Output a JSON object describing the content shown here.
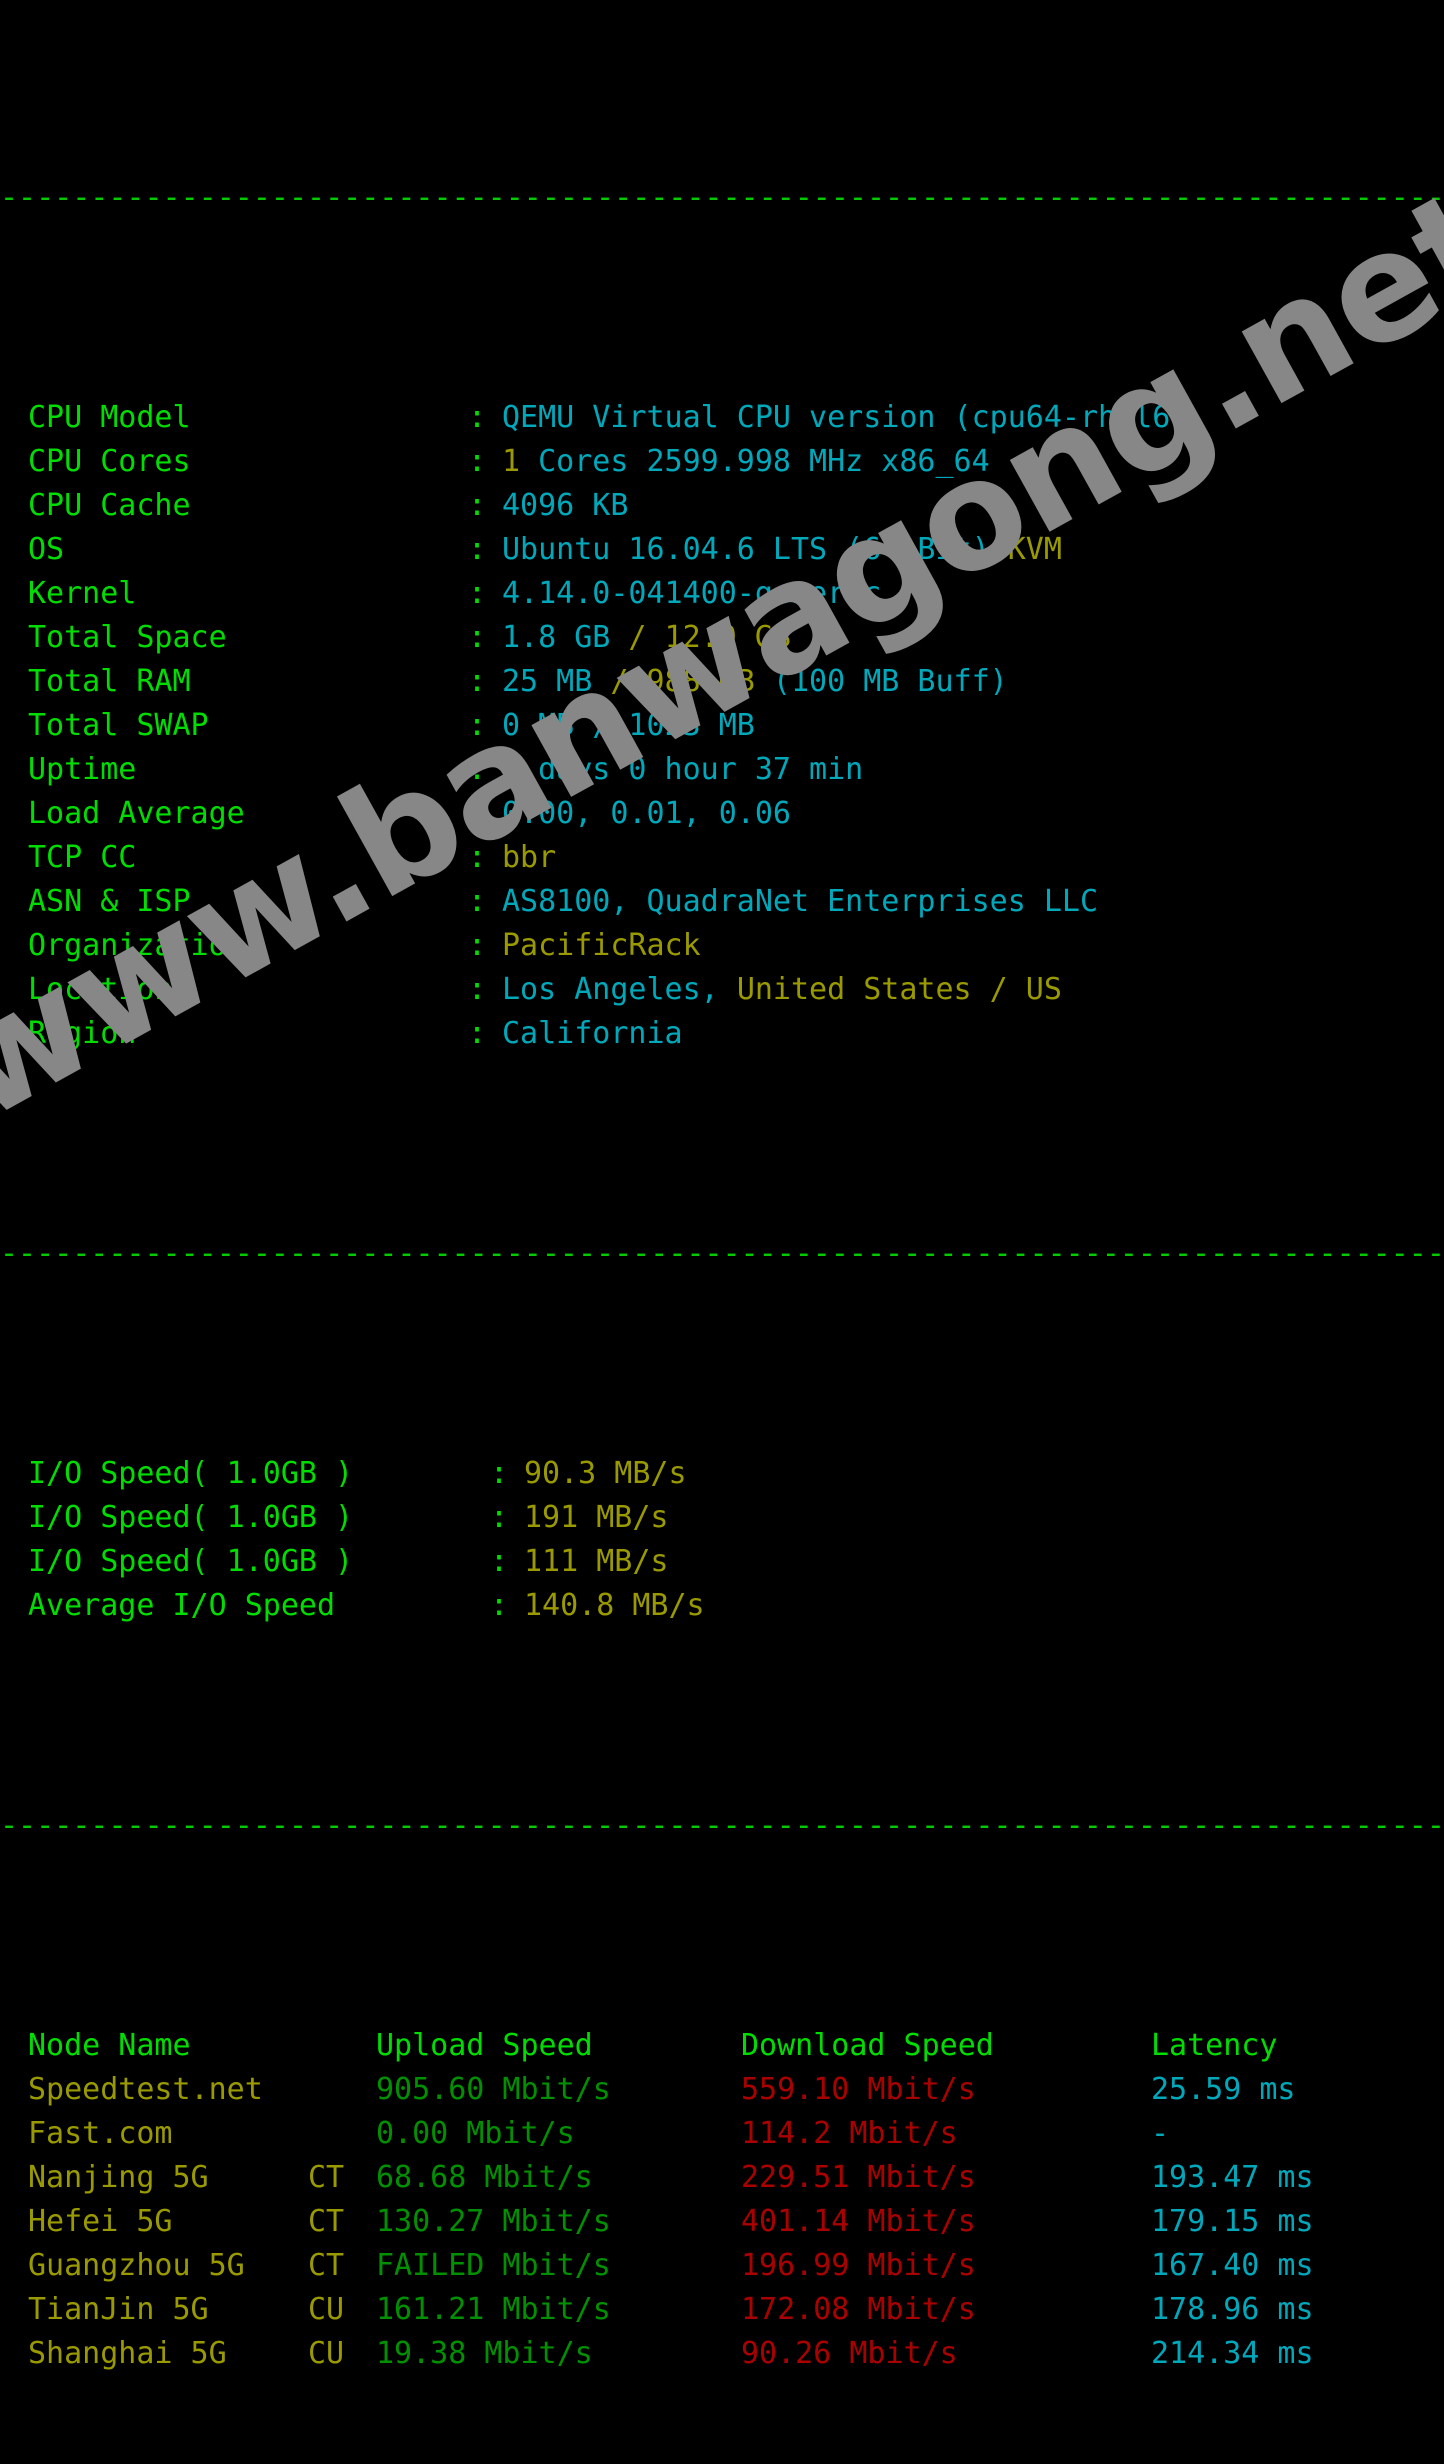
{
  "terminal": {
    "separator_char": "-",
    "colon": ":"
  },
  "watermark": {
    "text": "www.banwagong.net",
    "color": "#878787"
  },
  "colors": {
    "label_green": "#00dd00",
    "value_cyan": "#00a8bb",
    "value_yellow": "#9a9a00",
    "download_red": "#aa0000",
    "upload_green": "#009000",
    "separator_green": "#00cc00",
    "background": "#000000"
  },
  "system_info": [
    {
      "label": "CPU Model",
      "value": "QEMU Virtual CPU version (cpu64-rhel6)"
    },
    {
      "label": "CPU Cores",
      "value_a": "1",
      "value_b": " Cores 2599.998 MHz x86_64"
    },
    {
      "label": "CPU Cache",
      "value": "4096 KB"
    },
    {
      "label": "OS",
      "value_a": "Ubuntu 16.04.6 LTS (64 Bit) ",
      "value_b": "KVM"
    },
    {
      "label": "Kernel",
      "value": "4.14.0-041400-generic"
    },
    {
      "label": "Total Space",
      "value_a": "1.8 GB",
      "value_b": " / ",
      "value_c": "12.0 GB"
    },
    {
      "label": "Total RAM",
      "value_a": "25 MB",
      "value_b": " / ",
      "value_c": "988 MB",
      "value_d": " (100 MB Buff)"
    },
    {
      "label": "Total SWAP",
      "value": "0 MB / 1023 MB"
    },
    {
      "label": "Uptime",
      "value": "0 days 0 hour 37 min"
    },
    {
      "label": "Load Average",
      "value": "0.00, 0.01, 0.06"
    },
    {
      "label": "TCP CC",
      "value_yellow": "bbr"
    },
    {
      "label": "ASN & ISP",
      "value": "AS8100, QuadraNet Enterprises LLC"
    },
    {
      "label": "Organization",
      "value_yellow": "PacificRack"
    },
    {
      "label": "Location",
      "value_a": "Los Angeles, ",
      "value_b": "United States / US"
    },
    {
      "label": "Region",
      "value": "California"
    }
  ],
  "io_speed": [
    {
      "label": "I/O Speed( 1.0GB )",
      "value": "90.3 MB/s"
    },
    {
      "label": "I/O Speed( 1.0GB )",
      "value": "191 MB/s"
    },
    {
      "label": "I/O Speed( 1.0GB )",
      "value": "111 MB/s"
    },
    {
      "label": "Average I/O Speed",
      "value": "140.8 MB/s"
    }
  ],
  "speedtest": {
    "headers": {
      "node": "Node Name",
      "upload": "Upload Speed",
      "download": "Download Speed",
      "latency": "Latency"
    },
    "rows": [
      {
        "node": "Speedtest.net",
        "isp": "",
        "upload": "905.60 Mbit/s",
        "download": "559.10 Mbit/s",
        "latency": "25.59 ms"
      },
      {
        "node": "Fast.com",
        "isp": "",
        "upload": "0.00 Mbit/s",
        "download": "114.2 Mbit/s",
        "latency": "-"
      },
      {
        "node": "Nanjing 5G",
        "isp": "CT",
        "upload": "68.68 Mbit/s",
        "download": "229.51 Mbit/s",
        "latency": "193.47 ms"
      },
      {
        "node": "Hefei 5G",
        "isp": "CT",
        "upload": "130.27 Mbit/s",
        "download": "401.14 Mbit/s",
        "latency": "179.15 ms"
      },
      {
        "node": "Guangzhou 5G",
        "isp": "CT",
        "upload": "FAILED Mbit/s",
        "download": "196.99 Mbit/s",
        "latency": "167.40 ms"
      },
      {
        "node": "TianJin 5G",
        "isp": "CU",
        "upload": "161.21 Mbit/s",
        "download": "172.08 Mbit/s",
        "latency": "178.96 ms"
      },
      {
        "node": "Shanghai 5G",
        "isp": "CU",
        "upload": "19.38 Mbit/s",
        "download": "90.26 Mbit/s",
        "latency": "214.34 ms"
      }
    ]
  }
}
